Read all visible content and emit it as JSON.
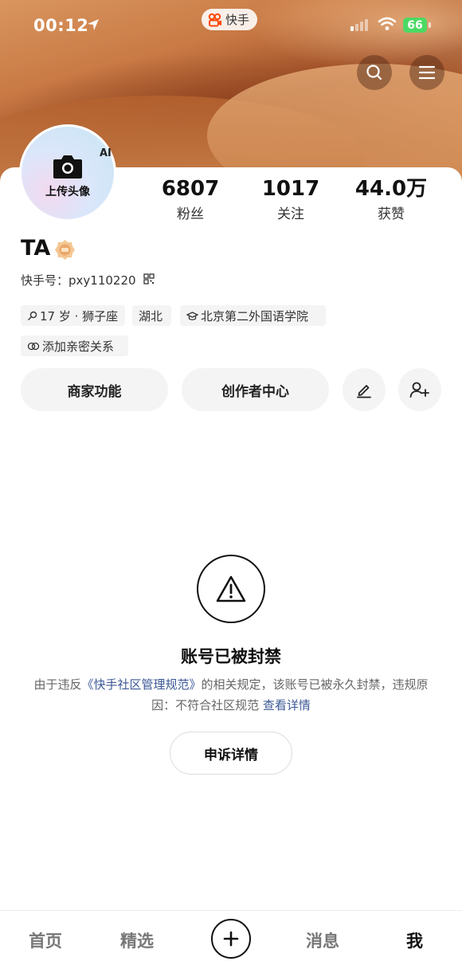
{
  "status_bar": {
    "time": "00:12",
    "app_name": "快手",
    "battery": "66"
  },
  "header": {
    "search_icon": "search-icon",
    "menu_icon": "menu-icon"
  },
  "avatar": {
    "ai_label": "AI",
    "upload_label": "上传头像"
  },
  "stats": {
    "fans": {
      "value": "6807",
      "label": "粉丝"
    },
    "following": {
      "value": "1017",
      "label": "关注"
    },
    "likes": {
      "value": "44.0万",
      "label": "获赞"
    }
  },
  "profile": {
    "name": "TA",
    "kuaishou_id": "快手号：pxy110220"
  },
  "tags": {
    "age": "17 岁 · 狮子座",
    "region": "湖北",
    "school": "北京第二外国语学院",
    "relationship": "添加亲密关系"
  },
  "actions": {
    "merchant": "商家功能",
    "creator": "创作者中心"
  },
  "ban": {
    "title": "账号已被封禁",
    "desc_part1": "由于违反",
    "desc_link1": "《快手社区管理规范》",
    "desc_part2": "的相关规定，该账号已被永久封禁，违规原因：不符合社区规范 ",
    "desc_link2": "查看详情",
    "appeal": "申诉详情"
  },
  "tabbar": {
    "home": "首页",
    "featured": "精选",
    "messages": "消息",
    "me": "我"
  },
  "colors": {
    "accent_link": "#3c5896",
    "battery_green": "#4cd964"
  }
}
